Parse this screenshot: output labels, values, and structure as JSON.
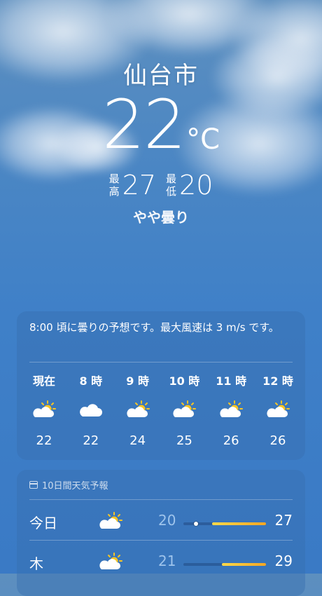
{
  "location": {
    "city": "仙台市"
  },
  "current": {
    "temperature": "22",
    "unit": "°C",
    "high_label": [
      "最",
      "高"
    ],
    "high": "27",
    "low_label": [
      "最",
      "低"
    ],
    "low": "20",
    "condition": "やや曇り"
  },
  "hourly": {
    "summary": "8:00 頃に曇りの予想です。最大風速は 3 m/s です。",
    "hours": [
      {
        "label": "現在",
        "icon": "partly-sunny-icon",
        "temp": "22"
      },
      {
        "label": "8 時",
        "icon": "cloud-icon",
        "temp": "22"
      },
      {
        "label": "9 時",
        "icon": "partly-sunny-icon",
        "temp": "24"
      },
      {
        "label": "10 時",
        "icon": "partly-sunny-icon",
        "temp": "25"
      },
      {
        "label": "11 時",
        "icon": "partly-sunny-icon",
        "temp": "26"
      },
      {
        "label": "12 時",
        "icon": "partly-sunny-icon",
        "temp": "26"
      }
    ]
  },
  "daily": {
    "header": "10日間天気予報",
    "days": [
      {
        "name": "今日",
        "icon": "partly-sunny-icon",
        "low": "20",
        "high": "27",
        "range_start": 0.35,
        "range_end": 1.0,
        "current_marker": 0.15
      },
      {
        "name": "木",
        "icon": "partly-sunny-icon",
        "low": "21",
        "high": "29",
        "range_start": 0.47,
        "range_end": 1.0
      }
    ]
  },
  "colors": {
    "sun": "#f9c623",
    "bar_start": "#ffd94a",
    "bar_end": "#f5a623",
    "low_temp": "#9ec4ec"
  }
}
